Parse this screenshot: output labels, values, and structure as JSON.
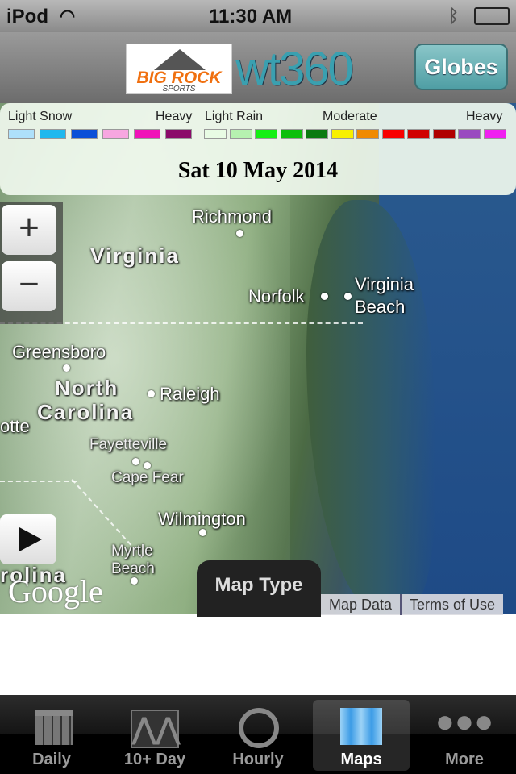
{
  "status": {
    "carrier": "iPod",
    "time": "11:30 AM"
  },
  "header": {
    "brand": "BIG ROCK",
    "brand_sub": "SPORTS",
    "app_logo": "wt360",
    "globes_label": "Globes"
  },
  "legend": {
    "snow_label": "Light Snow",
    "snow_heavy": "Heavy",
    "rain_label": "Light Rain",
    "rain_moderate": "Moderate",
    "rain_heavy": "Heavy",
    "snow_colors": [
      "#aee0fb",
      "#1fb8ee",
      "#0a4fd8",
      "#f7a6e0",
      "#f012b8",
      "#8b0a6a"
    ],
    "rain_colors": [
      "#e8fbe4",
      "#b6f2b0",
      "#14f014",
      "#0cbf0c",
      "#0a7a10",
      "#f8f000",
      "#f08a00",
      "#f80000",
      "#d00000",
      "#b00000",
      "#9a4ac0",
      "#f020f0"
    ],
    "date": "Sat 10 May 2014"
  },
  "map": {
    "labels": {
      "richmond": "Richmond",
      "virginia": "Virginia",
      "norfolk": "Norfolk",
      "virginia_beach_1": "Virginia",
      "virginia_beach_2": "Beach",
      "greensboro": "Greensboro",
      "north": "North",
      "carolina": "Carolina",
      "raleigh": "Raleigh",
      "charlotte": "otte",
      "fayetteville": "Fayetteville",
      "cape_fear": "Cape Fear",
      "wilmington": "Wilmington",
      "myrtle": "Myrtle",
      "beach": "Beach",
      "carolina2": "rolina"
    },
    "zoom_in": "+",
    "zoom_out": "−",
    "google": "Google",
    "map_type": "Map Type",
    "map_data": "Map Data",
    "terms": "Terms of Use"
  },
  "tabs": [
    {
      "label": "Daily",
      "icon": "calendar-icon"
    },
    {
      "label": "10+ Day",
      "icon": "chart-icon"
    },
    {
      "label": "Hourly",
      "icon": "clock-icon"
    },
    {
      "label": "Maps",
      "icon": "map-icon",
      "active": true
    },
    {
      "label": "More",
      "icon": "more-icon"
    }
  ]
}
